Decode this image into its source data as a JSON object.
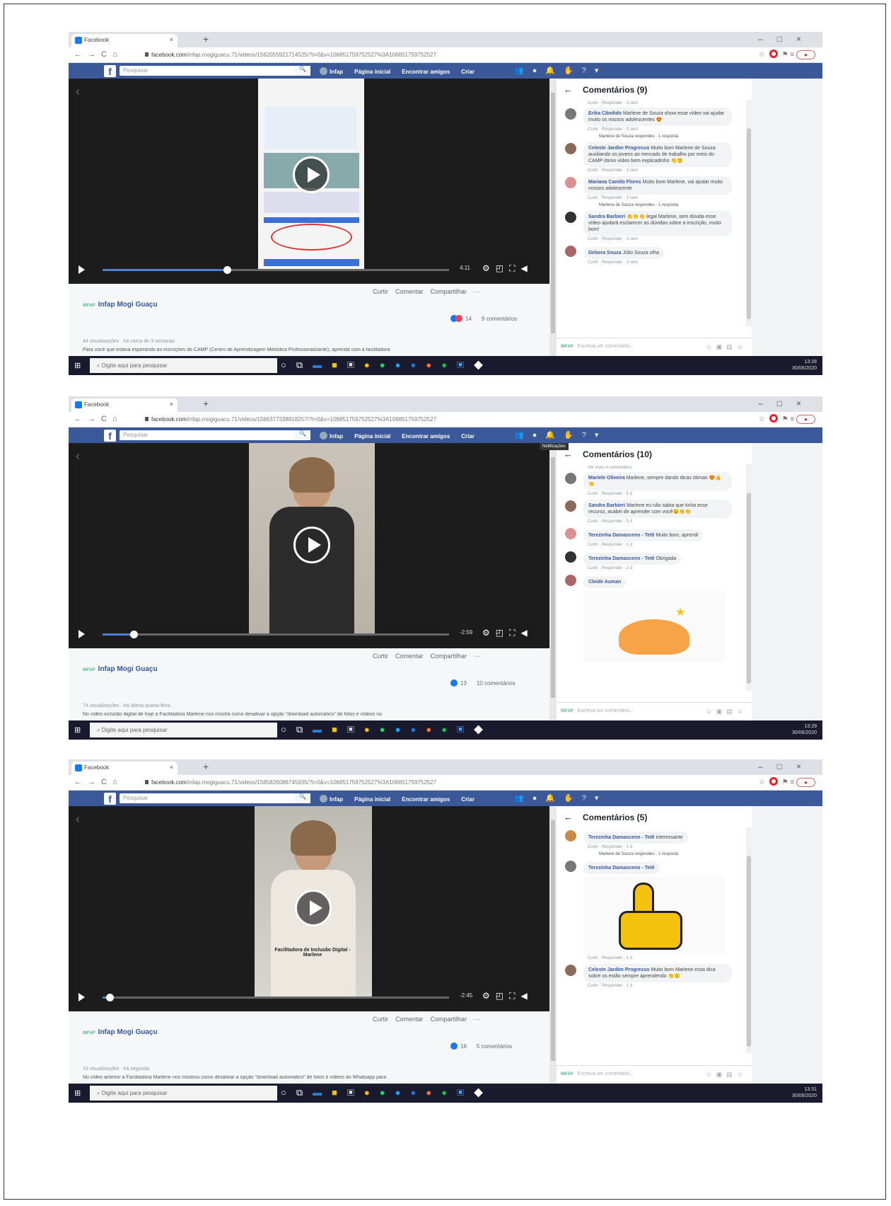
{
  "screenshots": [
    {
      "tab_title": "Facebook",
      "url_domain": "facebook.com",
      "url_path": "/infap.mogiguacu.71/videos/1562055921714525/?t=0&v=106851759752527%3A106851759752527",
      "fb_search": "Pesquisar",
      "fb_nav": [
        "Infap",
        "Página inicial",
        "Encontrar amigos",
        "Criar"
      ],
      "comments_title": "Comentários (9)",
      "time_label": "4:11",
      "progress_fraction": 0.36,
      "actions": [
        "Curtir",
        "Comentar",
        "Compartilhar",
        "···"
      ],
      "page_name": "Infap Mogi Guaçu",
      "reactions_count": "14",
      "comments_count": "9 comentários",
      "meta": "44 visualizações · há cerca de 3 semanas",
      "post_text": "Para você que estava esperando as inscrições do CAMP (Centro de Aprendizagem Metódica Profissionalizante), aprenda com a facilitadora",
      "comments": [
        {
          "top_line": "Curtir · Responder · 3 sem"
        },
        {
          "name": "Erika Cândido",
          "text": "Marlene de Souza show esse vídeo vai ajudar muito os nossos adolescentes 😍",
          "meta": "Curtir · Responder · 3 sem",
          "reply": "Marlene de Souza respondeu · 1 resposta"
        },
        {
          "name": "Celeste Jardim Progresso",
          "text": "Muito bom Marlene de Souza auxiliando os jovens ao mercado de trabalho por meio do CAMP ótimo vídeo bem explicadinho 👏🙂",
          "meta": "Curtir · Responder · 3 sem"
        },
        {
          "name": "Mariana Camilo Flores",
          "text": "Muito bom Marlene, vai ajudar muito nossos adolescente",
          "meta": "Curtir · Responder · 3 sem",
          "reply": "Marlene de Souza respondeu · 1 resposta"
        },
        {
          "name": "Sandra Barbieri",
          "text": "👏👏👏 legal Marlene, sem dúvida esse vídeo ajudará esclarecer as dúvidas sobre a inscrição, muito bom!",
          "meta": "Curtir · Responder · 3 sem"
        },
        {
          "name": "Debora Souza",
          "text": "Júlio Souza olha",
          "meta": "Curtir · Responder · 3 sem"
        }
      ],
      "composer": "Escreva um comentário...",
      "tray_time": "13:28",
      "tray_date": "30/06/2020"
    },
    {
      "tab_title": "Facebook",
      "url_domain": "facebook.com",
      "url_path": "/infap.mogiguacu.71/videos/1566377338918257/?t=0&v=106851759752527%3A106851759752527",
      "fb_search": "Pesquisar",
      "fb_nav": [
        "Infap",
        "Página inicial",
        "Encontrar amigos",
        "Criar"
      ],
      "comments_title": "Comentários (10)",
      "tooltip": "Notificações",
      "time_label": "-2:59",
      "progress_fraction": 0.09,
      "actions": [
        "Curtir",
        "Comentar",
        "Compartilhar",
        "···"
      ],
      "page_name": "Infap Mogi Guaçu",
      "reactions_count": "13",
      "comments_count": "10 comentários",
      "meta": "74 visualizações · há última quarta-feira",
      "post_text": "No vídeo inclusão digital de hoje a Facilitadora Marlene nos mostra como desativar a opção \"download automático\" de fotos e vídeos no",
      "comments": [
        {
          "top_line": "Ver mais 4 comentários"
        },
        {
          "name": "Mariele Oliveira",
          "text": "Marlene, sempre dando dicas ótimas 😍👍👏",
          "meta": "Curtir · Responder · 5 d"
        },
        {
          "name": "Sandra Barbieri",
          "text": "Marlene eu não sabia que tinha esse recurso, acabei de aprender com você😉👏👏",
          "meta": "Curtir · Responder · 5 d"
        },
        {
          "name": "Terezinha Damasceno - Tetê",
          "text": "Muito bom, aprendi",
          "meta": "Curtir · Responder · 1 d"
        },
        {
          "name": "Terezinha Damasceno - Tetê",
          "text": "Obrigada",
          "meta": "Curtir · Responder · 1 d"
        },
        {
          "name": "Cleide Auman",
          "text": "",
          "sticker": "clap"
        }
      ],
      "composer": "Escreva um comentário...",
      "tray_time": "13:29",
      "tray_date": "30/06/2020"
    },
    {
      "tab_title": "Facebook",
      "url_domain": "facebook.com",
      "url_path": "/infap.mogiguacu.71/videos/1565826086745935/?t=0&v=106851759752527%3A106851759752527",
      "fb_search": "Pesquisar",
      "fb_nav": [
        "Infap",
        "Página inicial",
        "Encontrar amigos",
        "Criar"
      ],
      "comments_title": "Comentários (5)",
      "caption": "Facilitadora de Inclusão Digital - Marlene",
      "time_label": "-2:45",
      "progress_fraction": 0.02,
      "actions": [
        "Curtir",
        "Comentar",
        "Compartilhar",
        "···"
      ],
      "page_name": "Infap Mogi Guaçu",
      "reactions_count": "16",
      "comments_count": "5 comentários",
      "meta": "23 visualizações · há segunda",
      "post_text": "No vídeo anterior a Facilitadora Marlene nos mostrou como desativar a opção \"download automático\" de fotos e vídeos do Whatsapp para",
      "comments": [
        {
          "name": "Terezinha Damasceno - Tetê",
          "text": "interessante",
          "meta": "Curtir · Responder · 1 d",
          "reply": "Marlene de Souza respondeu · 1 resposta"
        },
        {
          "name": "Terezinha Damasceno - Tetê",
          "text": "",
          "sticker": "thumb",
          "meta": "Curtir · Responder · 1 d"
        },
        {
          "name": "Celeste Jardim Progresso",
          "text": "Muito bom Marlene essa dica sobre os estão sempre aprendendo 👏🙂",
          "meta": "Curtir · Responder · 1 d"
        }
      ],
      "composer": "Escreva um comentário...",
      "tray_time": "13:31",
      "tray_date": "30/06/2020"
    }
  ],
  "taskbar_search": "Digite aqui para pesquisar",
  "colors": {
    "fb_blue": "#3b5998",
    "link": "#385898",
    "taskbar": "#1a1a2e"
  }
}
